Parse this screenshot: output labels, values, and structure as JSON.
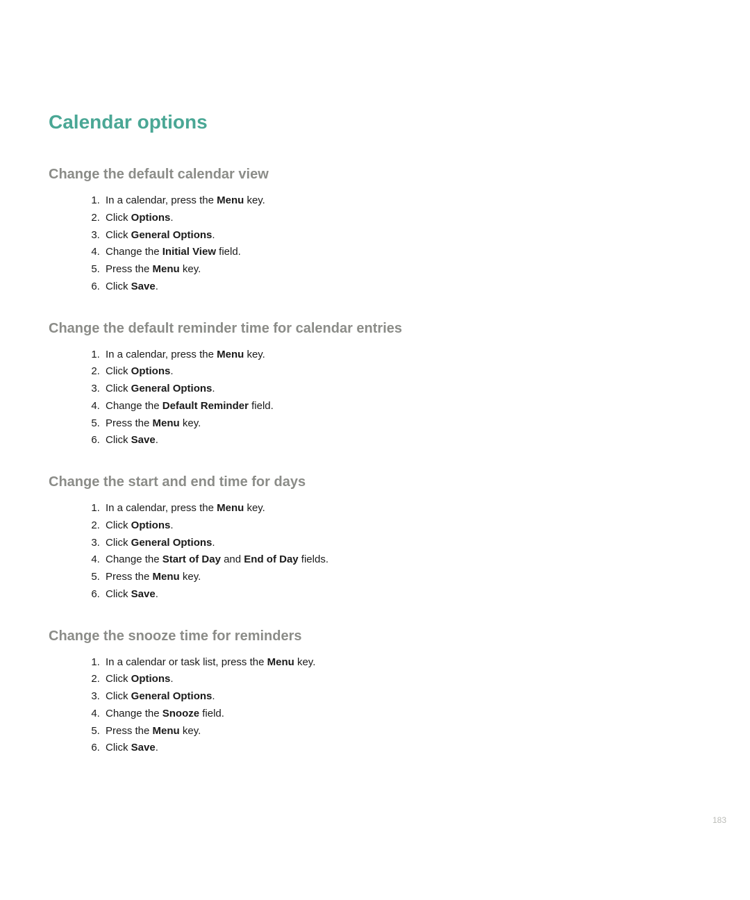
{
  "title": "Calendar options",
  "sections": [
    {
      "heading": "Change the default calendar view",
      "steps": [
        [
          {
            "t": "In a calendar, press the "
          },
          {
            "t": "Menu",
            "b": true
          },
          {
            "t": " key."
          }
        ],
        [
          {
            "t": "Click "
          },
          {
            "t": "Options",
            "b": true
          },
          {
            "t": "."
          }
        ],
        [
          {
            "t": "Click "
          },
          {
            "t": "General Options",
            "b": true
          },
          {
            "t": "."
          }
        ],
        [
          {
            "t": "Change the "
          },
          {
            "t": "Initial View",
            "b": true
          },
          {
            "t": " field."
          }
        ],
        [
          {
            "t": "Press the "
          },
          {
            "t": "Menu",
            "b": true
          },
          {
            "t": " key."
          }
        ],
        [
          {
            "t": "Click "
          },
          {
            "t": "Save",
            "b": true
          },
          {
            "t": "."
          }
        ]
      ]
    },
    {
      "heading": "Change the default reminder time for calendar entries",
      "steps": [
        [
          {
            "t": "In a calendar, press the "
          },
          {
            "t": "Menu",
            "b": true
          },
          {
            "t": " key."
          }
        ],
        [
          {
            "t": "Click "
          },
          {
            "t": "Options",
            "b": true
          },
          {
            "t": "."
          }
        ],
        [
          {
            "t": "Click "
          },
          {
            "t": "General Options",
            "b": true
          },
          {
            "t": "."
          }
        ],
        [
          {
            "t": "Change the "
          },
          {
            "t": "Default Reminder",
            "b": true
          },
          {
            "t": " field."
          }
        ],
        [
          {
            "t": "Press the "
          },
          {
            "t": "Menu",
            "b": true
          },
          {
            "t": " key."
          }
        ],
        [
          {
            "t": "Click "
          },
          {
            "t": "Save",
            "b": true
          },
          {
            "t": "."
          }
        ]
      ]
    },
    {
      "heading": "Change the start and end time for days",
      "steps": [
        [
          {
            "t": "In a calendar, press the "
          },
          {
            "t": "Menu",
            "b": true
          },
          {
            "t": " key."
          }
        ],
        [
          {
            "t": "Click "
          },
          {
            "t": "Options",
            "b": true
          },
          {
            "t": "."
          }
        ],
        [
          {
            "t": "Click "
          },
          {
            "t": "General Options",
            "b": true
          },
          {
            "t": "."
          }
        ],
        [
          {
            "t": "Change the "
          },
          {
            "t": "Start of Day",
            "b": true
          },
          {
            "t": " and "
          },
          {
            "t": "End of Day",
            "b": true
          },
          {
            "t": " fields."
          }
        ],
        [
          {
            "t": "Press the "
          },
          {
            "t": "Menu",
            "b": true
          },
          {
            "t": " key."
          }
        ],
        [
          {
            "t": "Click "
          },
          {
            "t": "Save",
            "b": true
          },
          {
            "t": "."
          }
        ]
      ]
    },
    {
      "heading": "Change the snooze time for reminders",
      "steps": [
        [
          {
            "t": "In a calendar or task list, press the "
          },
          {
            "t": "Menu",
            "b": true
          },
          {
            "t": " key."
          }
        ],
        [
          {
            "t": "Click "
          },
          {
            "t": "Options",
            "b": true
          },
          {
            "t": "."
          }
        ],
        [
          {
            "t": "Click "
          },
          {
            "t": "General Options",
            "b": true
          },
          {
            "t": "."
          }
        ],
        [
          {
            "t": "Change the "
          },
          {
            "t": "Snooze",
            "b": true
          },
          {
            "t": " field."
          }
        ],
        [
          {
            "t": "Press the "
          },
          {
            "t": "Menu",
            "b": true
          },
          {
            "t": " key."
          }
        ],
        [
          {
            "t": "Click "
          },
          {
            "t": "Save",
            "b": true
          },
          {
            "t": "."
          }
        ]
      ]
    }
  ],
  "page_number": "183"
}
